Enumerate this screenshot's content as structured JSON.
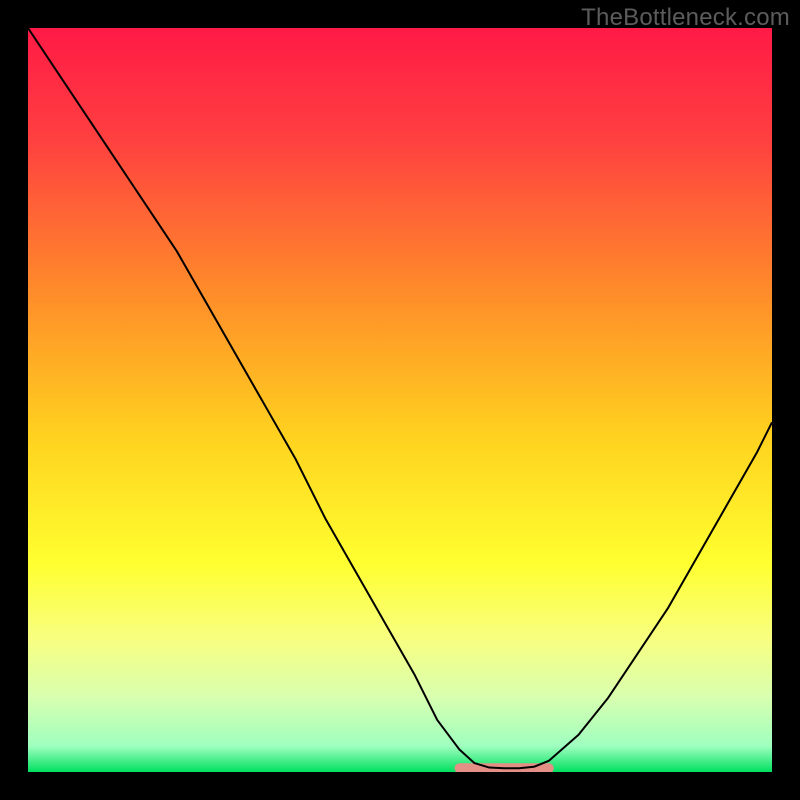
{
  "watermark": "TheBottleneck.com",
  "chart_data": {
    "type": "line",
    "title": "",
    "xlabel": "",
    "ylabel": "",
    "xlim": [
      0,
      100
    ],
    "ylim": [
      0,
      100
    ],
    "grid": false,
    "legend": false,
    "background_gradient": {
      "stops": [
        {
          "offset": 0.0,
          "color": "#ff1a46"
        },
        {
          "offset": 0.15,
          "color": "#ff4040"
        },
        {
          "offset": 0.35,
          "color": "#ff8a2a"
        },
        {
          "offset": 0.55,
          "color": "#ffd21f"
        },
        {
          "offset": 0.72,
          "color": "#ffff30"
        },
        {
          "offset": 0.82,
          "color": "#f8ff80"
        },
        {
          "offset": 0.9,
          "color": "#d8ffb0"
        },
        {
          "offset": 0.965,
          "color": "#9fffbf"
        },
        {
          "offset": 1.0,
          "color": "#00e060"
        }
      ]
    },
    "series": [
      {
        "name": "bottleneck-curve",
        "stroke": "#000000",
        "stroke_width": 2,
        "x": [
          0,
          4,
          8,
          12,
          16,
          20,
          24,
          28,
          32,
          36,
          40,
          44,
          48,
          52,
          55,
          58,
          60,
          62,
          64,
          66,
          68,
          70,
          74,
          78,
          82,
          86,
          90,
          94,
          98,
          100
        ],
        "values": [
          100,
          94,
          88,
          82,
          76,
          70,
          63,
          56,
          49,
          42,
          34,
          27,
          20,
          13,
          7,
          3,
          1.2,
          0.6,
          0.5,
          0.5,
          0.7,
          1.5,
          5,
          10,
          16,
          22,
          29,
          36,
          43,
          47
        ]
      }
    ],
    "flat_band": {
      "name": "optimal-zone-marker",
      "color": "#e38f86",
      "x_start": 58,
      "x_end": 70,
      "y": 0.5,
      "thickness": 10
    }
  }
}
